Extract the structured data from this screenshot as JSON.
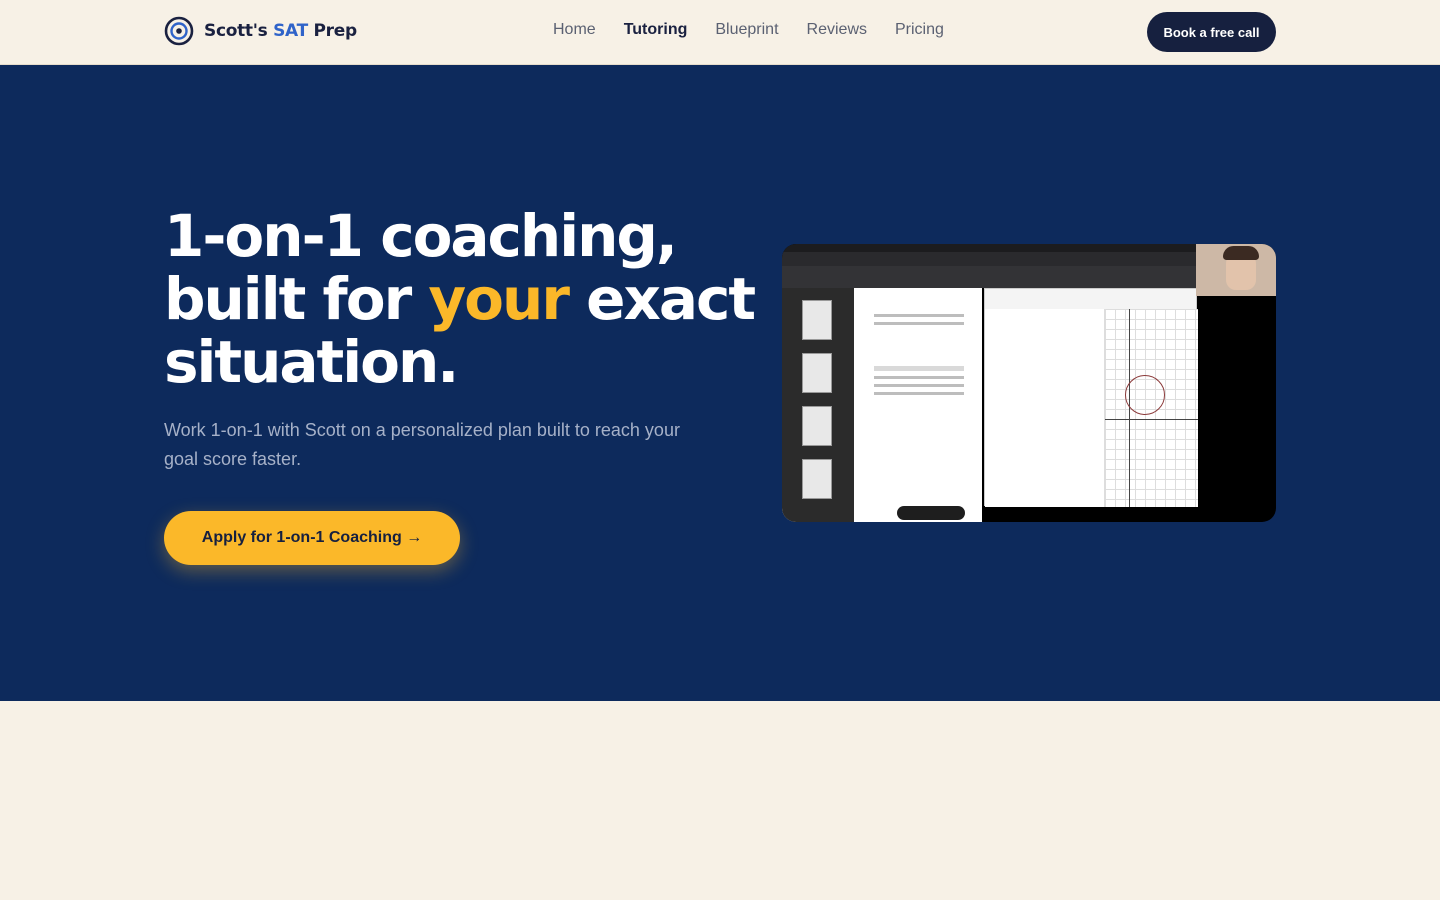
{
  "header": {
    "brand_prefix": "Scott's",
    "brand_accent": "SAT",
    "brand_suffix": "Prep",
    "nav": [
      {
        "label": "Home"
      },
      {
        "label": "Tutoring"
      },
      {
        "label": "Blueprint"
      },
      {
        "label": "Reviews"
      },
      {
        "label": "Pricing"
      }
    ],
    "active_nav": "Tutoring",
    "cta_label": "Book a free call"
  },
  "hero": {
    "headline_line1": "1-on-1 coaching,",
    "headline_line2_start": "built for ",
    "headline_highlight": "your",
    "headline_line2_end": " exact",
    "headline_line3": "situation.",
    "subtitle": "Work 1-on-1 with Scott on a personalized plan built to reach your goal score faster.",
    "cta_label": "Apply for 1-on-1 Coaching →"
  },
  "colors": {
    "navy": "#0d2a5c",
    "cream": "#f7f1e6",
    "accent_yellow": "#fbb829",
    "brand_blue": "#2f63c9",
    "dark_button": "#16203f"
  },
  "icons": {
    "brand": "target-icon"
  }
}
